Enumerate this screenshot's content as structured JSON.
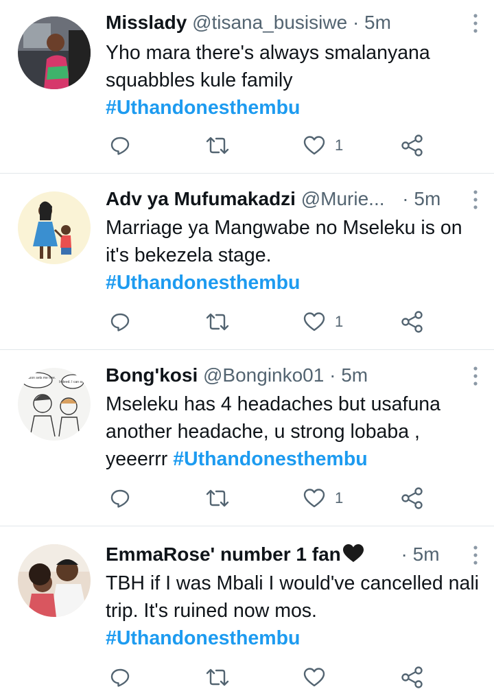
{
  "tweets": [
    {
      "name": "Misslady",
      "handle": "@tisana_busisiwe",
      "separator": "·",
      "time": "5m",
      "text": "Yho mara there's always smalanyana squabbles kule family",
      "hashtag": "#Uthandonesthembu",
      "likes": "1",
      "avatar_icon": "woman-car-avatar"
    },
    {
      "name": "Adv ya Mufumakadzi",
      "handle": "@Murie...",
      "separator": "·",
      "time": "5m",
      "text": "Marriage ya Mangwabe no Mseleku is on it's bekezela stage.",
      "hashtag": "#Uthandonesthembu",
      "likes": "1",
      "avatar_icon": "mother-child-illustration-avatar"
    },
    {
      "name": "Bong'kosi",
      "handle": "@Bonginko01",
      "separator": "·",
      "time": "5m",
      "text": "Mseleku has 4 headaches but usafuna another headache, u strong lobaba , yeeerrr",
      "hashtag": "#Uthandonesthembu",
      "likes": "1",
      "avatar_icon": "sketch-cartoon-avatar",
      "avatar_bubble_left": "destination sets me free.",
      "avatar_bubble_right": "Indeed. I can see."
    },
    {
      "name": "EmmaRose' number 1 fan",
      "name_suffix_icon": "black-heart-emoji",
      "handle": "",
      "separator": "·",
      "time": "5m",
      "text": "TBH if I was Mbali I would've cancelled nali trip. It's ruined now mos.",
      "hashtag": "#Uthandonesthembu",
      "likes": "",
      "avatar_icon": "couple-photo-avatar"
    }
  ],
  "colors": {
    "accent": "#1d9bf0",
    "secondary_text": "#536471",
    "icon": "#536471",
    "divider": "#e1e6ea"
  }
}
